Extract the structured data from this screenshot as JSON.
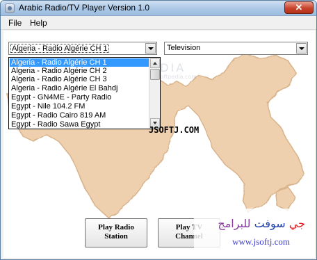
{
  "window": {
    "title": "Arabic Radio/TV Player Version 1.0",
    "close_glyph": "✕"
  },
  "menu": {
    "file": "File",
    "help": "Help"
  },
  "station_select": {
    "value": "Algeria - Radio Algérie CH 1"
  },
  "media_type_select": {
    "value": "Television"
  },
  "dropdown": {
    "items": [
      "Algeria - Radio Algérie CH 1",
      "Algeria - Radio Algérie CH 2",
      "Algeria - Radio Algérie CH 3",
      "Algeria - Radio Algérie El Bahdj",
      "Egypt - GN4ME - Party Radio",
      "Egypt - Nile 104.2 FM",
      "Egypt - Radio Cairo 819 AM",
      "Egypt - Radio Sawa Egypt"
    ],
    "selected_index": 0
  },
  "watermarks": {
    "softpedia": "SOFTPEDIA",
    "softpedia_url": "www.softpedia.com"
  },
  "center_label": "JSOFTJ.COM",
  "buttons": {
    "play_radio_line1": "Play Radio",
    "play_radio_line2": "Station",
    "play_tv_line1": "Play TV",
    "play_tv_line2": "Channel"
  },
  "logo": {
    "arabic_part1": "جي",
    "arabic_part2": "سوفت",
    "arabic_part3": "للبرامج",
    "url": "www.jsoftj.com"
  },
  "colors": {
    "map": "#efd0ae",
    "selection": "#3399ff",
    "logo_red": "#e02020",
    "logo_blue": "#1f3fa8"
  }
}
